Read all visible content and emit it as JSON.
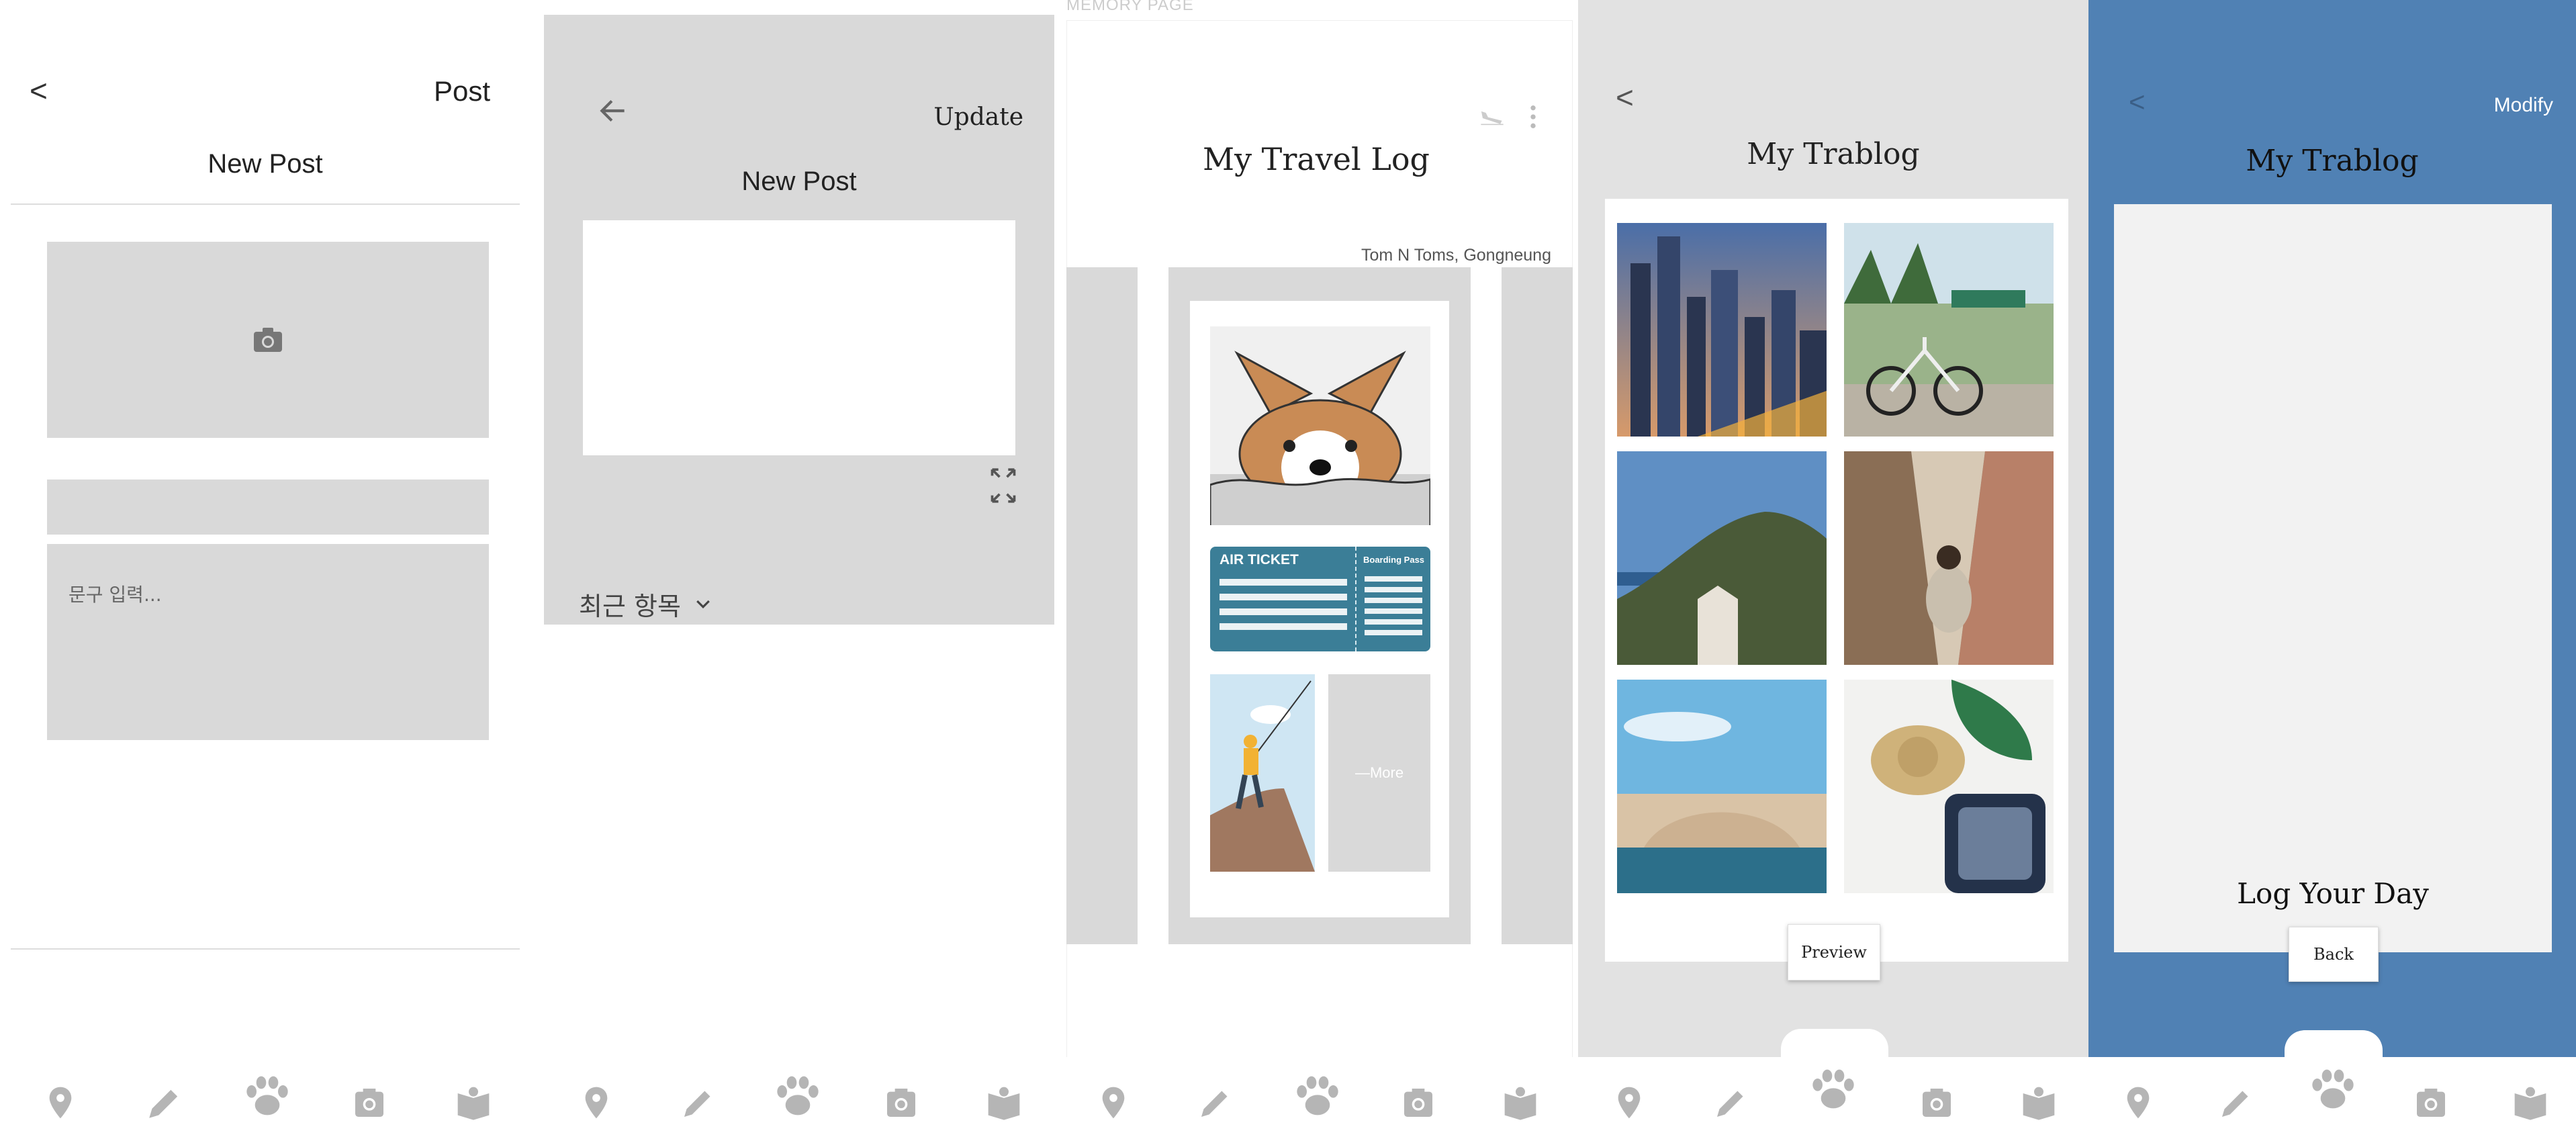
{
  "screen1": {
    "back": "<",
    "post": "Post",
    "title": "New Post",
    "text_placeholder": "문구 입력..."
  },
  "screen2": {
    "update": "Update",
    "title": "New Post",
    "recent": "최근 항목"
  },
  "screen3": {
    "top_label": "MEMORY PAGE",
    "title": "My  Travel  Log",
    "author": "Tom N Toms, Gongneung",
    "ticket_left": "AIR TICKET",
    "ticket_right": "Boarding Pass",
    "more": "—More"
  },
  "screen4": {
    "back": "<",
    "title": "My  Trablog",
    "preview": "Preview"
  },
  "screen5": {
    "back": "<",
    "modify": "Modify",
    "title": "My  Trablog",
    "log": "Log  Your  Day",
    "back_btn": "Back"
  },
  "nav_icons": [
    "location-pin-icon",
    "pencil-icon",
    "paw-icon",
    "camera-icon",
    "book-icon"
  ],
  "colors": {
    "accent_blue": "#5081b4",
    "panel_gray": "#d9d9d9",
    "icon_gray": "#b5b5b5"
  }
}
